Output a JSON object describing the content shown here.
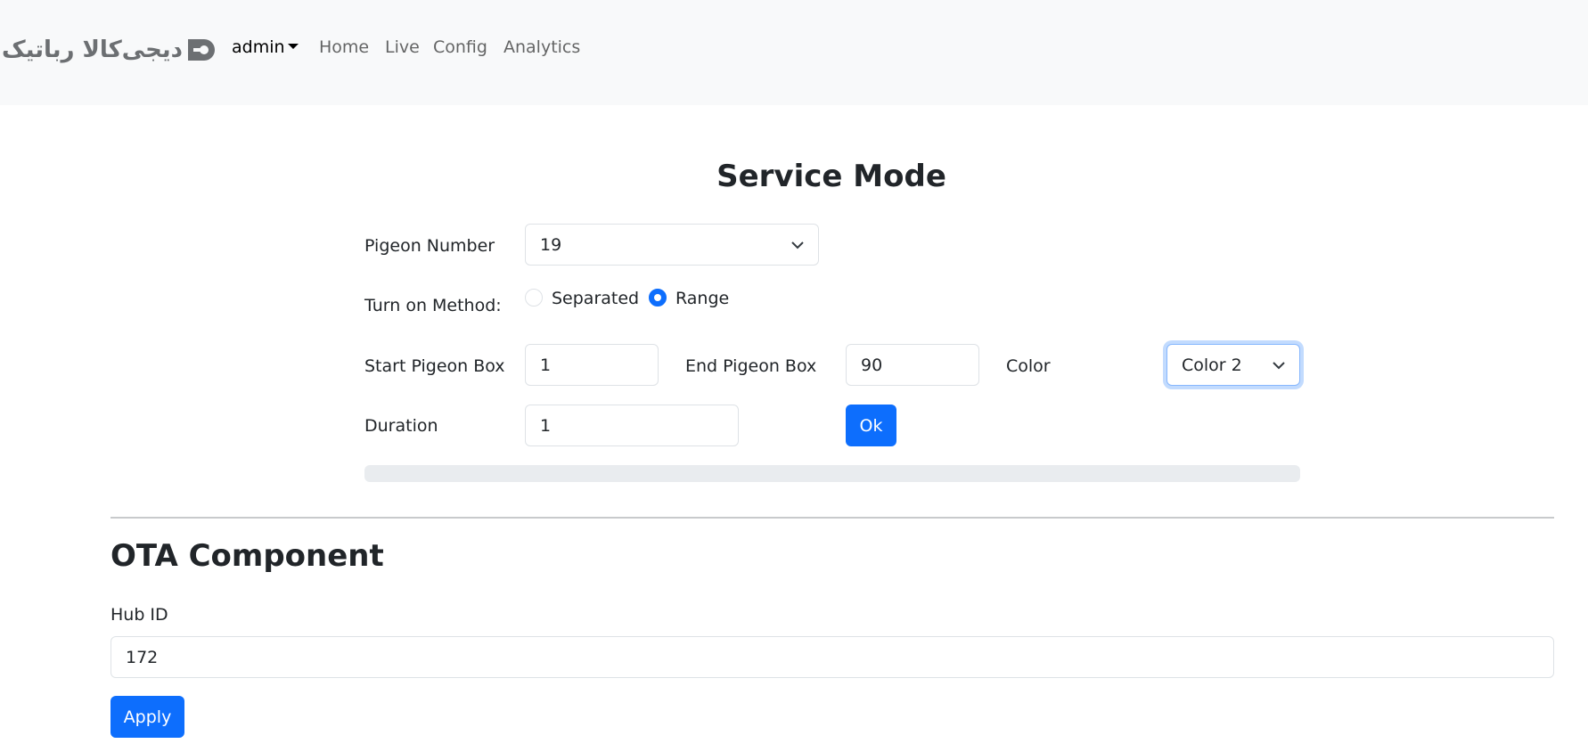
{
  "nav": {
    "brand_text": "دیجی‌کالا رباتیک",
    "user_menu": "admin",
    "links": [
      "Home",
      "Live",
      "Config",
      "Analytics"
    ]
  },
  "service_mode": {
    "title": "Service Mode",
    "pigeon_number": {
      "label": "Pigeon Number",
      "value": "19"
    },
    "turn_on_method": {
      "label": "Turn on Method:",
      "options": [
        "Separated",
        "Range"
      ],
      "selected": "Range"
    },
    "start_pigeon_box": {
      "label": "Start Pigeon Box",
      "value": "1"
    },
    "end_pigeon_box": {
      "label": "End Pigeon Box",
      "value": "90"
    },
    "color": {
      "label": "Color",
      "value": "Color 2"
    },
    "duration": {
      "label": "Duration",
      "value": "1"
    },
    "ok_button": "Ok",
    "progress_percent": 0
  },
  "ota": {
    "title": "OTA Component",
    "hub_id": {
      "label": "Hub ID",
      "value": "172"
    },
    "apply_button": "Apply"
  },
  "colors": {
    "primary": "#0d6efd",
    "navbar_bg": "#f8f9fa",
    "border": "#dee2e6",
    "progress_track": "#e9ecef"
  }
}
